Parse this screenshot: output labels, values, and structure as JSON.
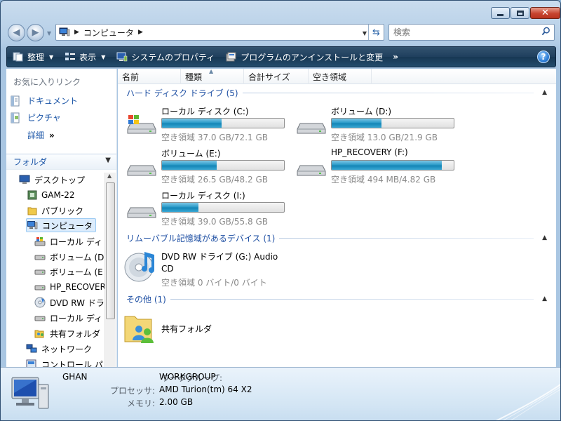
{
  "window": {
    "controls": [
      "minimize",
      "maximize",
      "close"
    ]
  },
  "address": {
    "path": "コンピュータ",
    "search_placeholder": "検索"
  },
  "toolbar": {
    "organize": "整理",
    "views": "表示",
    "system_properties": "システムのプロパティ",
    "uninstall": "プログラムのアンインストールと変更",
    "more": "»",
    "help": "?"
  },
  "nav": {
    "favorites_title": "お気に入りリンク",
    "favorites": [
      {
        "label": "ドキュメント",
        "icon": "documents-icon"
      },
      {
        "label": "ピクチャ",
        "icon": "pictures-icon"
      }
    ],
    "more_label": "詳細",
    "more_chevron": "»",
    "folders_label": "フォルダ",
    "tree": [
      {
        "label": "デスクトップ",
        "icon": "desktop-icon"
      },
      {
        "label": "GAM-22",
        "icon": "user-folder-icon"
      },
      {
        "label": "パブリック",
        "icon": "folder-icon"
      },
      {
        "label": "コンピュータ",
        "icon": "computer-icon",
        "selected": true
      },
      {
        "label": "ローカル ディ",
        "icon": "system-drive-icon"
      },
      {
        "label": "ボリューム (D",
        "icon": "drive-icon"
      },
      {
        "label": "ボリューム (E",
        "icon": "drive-icon"
      },
      {
        "label": "HP_RECOVER",
        "icon": "drive-icon"
      },
      {
        "label": "DVD RW ドラ",
        "icon": "dvd-drive-icon"
      },
      {
        "label": "ローカル ディ",
        "icon": "drive-icon"
      },
      {
        "label": "共有フォルダ",
        "icon": "shared-folder-icon"
      },
      {
        "label": "ネットワーク",
        "icon": "network-icon"
      },
      {
        "label": "コントロール パ",
        "icon": "control-panel-icon"
      }
    ]
  },
  "columns": [
    "名前",
    "種類",
    "合計サイズ",
    "空き領域"
  ],
  "groups": {
    "hdd": "ハード ディスク ドライブ (5)",
    "removable": "リムーバブル記憶域があるデバイス (1)",
    "other": "その他 (1)"
  },
  "drives": [
    {
      "name": "ローカル ディスク (C:)",
      "free": "空き領域 37.0 GB/72.1 GB",
      "used_fraction": 0.49,
      "system": true
    },
    {
      "name": "ボリューム (D:)",
      "free": "空き領域 13.0 GB/21.9 GB",
      "used_fraction": 0.41
    },
    {
      "name": "ボリューム (E:)",
      "free": "空き領域 26.5 GB/48.2 GB",
      "used_fraction": 0.45
    },
    {
      "name": "HP_RECOVERY (F:)",
      "free": "空き領域 494 MB/4.82 GB",
      "used_fraction": 0.9
    },
    {
      "name": "ローカル ディスク (I:)",
      "free": "空き領域 39.0 GB/55.8 GB",
      "used_fraction": 0.3
    }
  ],
  "dvd": {
    "name": "DVD RW ドライブ (G:) Audio CD",
    "free": "空き領域 0 バイト/0 バイト"
  },
  "shared": {
    "name": "共有フォルダ"
  },
  "details": {
    "computer_name": "GHAN",
    "workgroup_label": "ワークグループ:",
    "workgroup": "WORKGROUP",
    "processor_label": "プロセッサ:",
    "processor": "AMD Turion(tm) 64 X2",
    "memory_label": "メモリ:",
    "memory": "2.00 GB"
  }
}
